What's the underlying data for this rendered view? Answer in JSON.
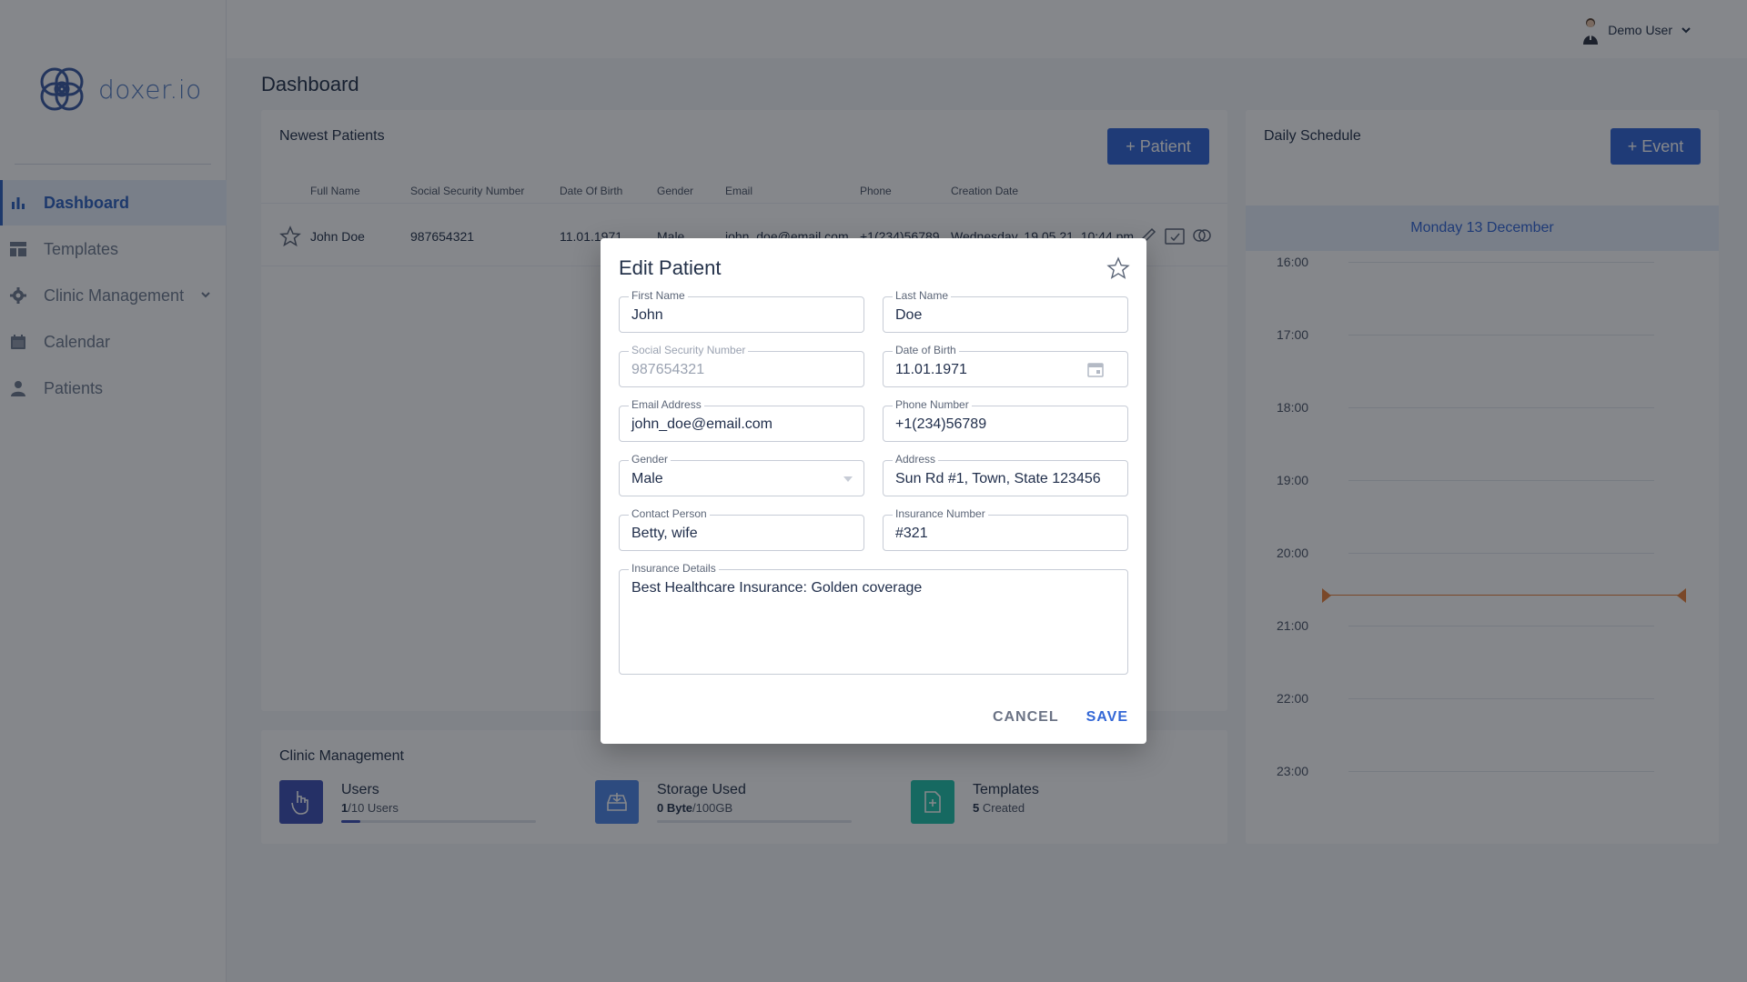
{
  "app": {
    "logo_text": "doxer.io",
    "user_name": "Demo User"
  },
  "sidebar": {
    "items": [
      {
        "label": "Dashboard",
        "icon": "bar-chart-icon",
        "active": true
      },
      {
        "label": "Templates",
        "icon": "template-icon"
      },
      {
        "label": "Clinic Management",
        "icon": "gear-icon",
        "expandable": true
      },
      {
        "label": "Calendar",
        "icon": "calendar-icon"
      },
      {
        "label": "Patients",
        "icon": "person-icon"
      }
    ]
  },
  "page": {
    "title": "Dashboard"
  },
  "patients_card": {
    "title": "Newest Patients",
    "add_button": "+ Patient",
    "columns": [
      "Full Name",
      "Social Security Number",
      "Date Of Birth",
      "Gender",
      "Email",
      "Phone",
      "Creation Date"
    ],
    "rows": [
      {
        "full_name": "John Doe",
        "ssn": "987654321",
        "dob": "11.01.1971",
        "gender": "Male",
        "email": "john_doe@email.com",
        "phone": "+1(234)56789",
        "created": "Wednesday, 19.05.21, 10:44 pm"
      }
    ]
  },
  "clinic_card": {
    "title": "Clinic Management",
    "stats": [
      {
        "label": "Users",
        "value_bold": "1",
        "value_rest": "/10 Users",
        "icon": "hand-pointer-icon",
        "color": "#3f51b5",
        "progress": 0.1
      },
      {
        "label": "Storage Used",
        "value_bold": "0 Byte",
        "value_rest": "/100GB",
        "icon": "storage-icon",
        "color": "#4f86e6",
        "progress": 0.0
      },
      {
        "label": "Templates",
        "value_bold": "5",
        "value_rest": " Created",
        "icon": "document-plus-icon",
        "color": "#20c3aa"
      }
    ]
  },
  "schedule": {
    "title": "Daily Schedule",
    "add_button": "+ Event",
    "date": "Monday 13 December",
    "hours": [
      "16:00",
      "17:00",
      "18:00",
      "19:00",
      "20:00",
      "21:00",
      "22:00",
      "23:00"
    ],
    "now_marker_color": "#e9803a"
  },
  "modal": {
    "title": "Edit Patient",
    "fields": {
      "first_name": {
        "label": "First Name",
        "value": "John"
      },
      "last_name": {
        "label": "Last Name",
        "value": "Doe"
      },
      "ssn": {
        "label": "Social Security Number",
        "value": "987654321"
      },
      "dob": {
        "label": "Date of Birth",
        "value": "11.01.1971"
      },
      "email": {
        "label": "Email Address",
        "value": "john_doe@email.com"
      },
      "phone": {
        "label": "Phone Number",
        "value": "+1(234)56789"
      },
      "gender": {
        "label": "Gender",
        "value": "Male"
      },
      "address": {
        "label": "Address",
        "value": "Sun Rd #1, Town, State 123456"
      },
      "contact": {
        "label": "Contact Person",
        "value": "Betty, wife"
      },
      "insurance_number": {
        "label": "Insurance Number",
        "value": "#321"
      },
      "insurance_details": {
        "label": "Insurance Details",
        "value": "Best Healthcare Insurance: Golden coverage"
      }
    },
    "cancel": "CANCEL",
    "save": "SAVE",
    "accent": "#3367d6"
  }
}
